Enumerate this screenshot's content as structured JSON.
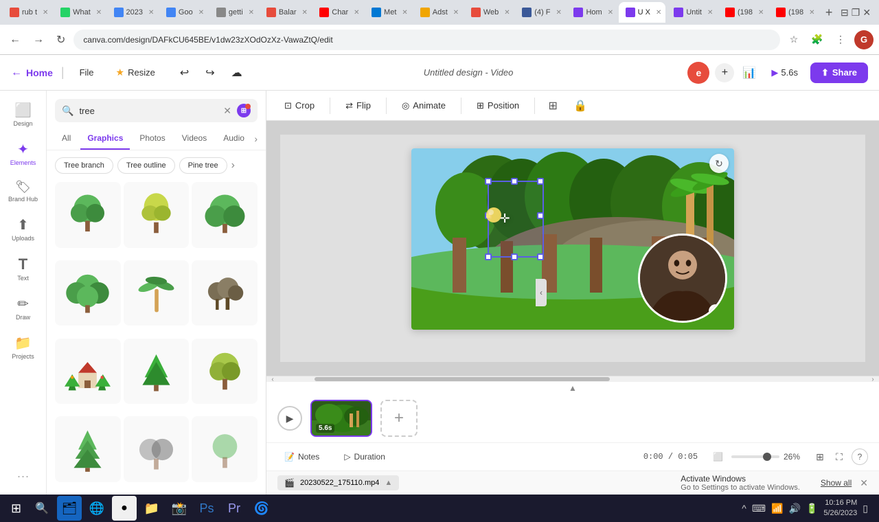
{
  "browser": {
    "url": "canva.com/design/DAFkCU645BE/v1dw23zXOdOzXz-VawaZtQ/edit",
    "tabs": [
      {
        "label": "rub t",
        "active": false,
        "favicon": "🔴"
      },
      {
        "label": "What",
        "active": false,
        "favicon": "💬"
      },
      {
        "label": "2023",
        "active": false,
        "favicon": "🌐"
      },
      {
        "label": "Goo",
        "active": false,
        "favicon": "🌐"
      },
      {
        "label": "getti",
        "active": false,
        "favicon": "🌐"
      },
      {
        "label": "Balar",
        "active": false,
        "favicon": "🌐"
      },
      {
        "label": "Char",
        "active": false,
        "favicon": "📺"
      },
      {
        "label": "Met",
        "active": false,
        "favicon": "🌐"
      },
      {
        "label": "Adst",
        "active": false,
        "favicon": "🌐"
      },
      {
        "label": "Web",
        "active": false,
        "favicon": "🌐"
      },
      {
        "label": "(4) F",
        "active": false,
        "favicon": "📘"
      },
      {
        "label": "Hom",
        "active": false,
        "favicon": "🌐"
      },
      {
        "label": "U X",
        "active": true,
        "favicon": "🌐"
      },
      {
        "label": "Untit",
        "active": false,
        "favicon": "🌐"
      },
      {
        "label": "(198",
        "active": false,
        "favicon": "📺"
      },
      {
        "label": "(198",
        "active": false,
        "favicon": "📺"
      }
    ]
  },
  "toolbar": {
    "home_label": "Home",
    "file_label": "File",
    "resize_label": "Resize",
    "title": "Untitled design - Video",
    "play_label": "5.6s",
    "share_label": "Share",
    "undo_symbol": "↩",
    "redo_symbol": "↪",
    "save_symbol": "☁"
  },
  "sidebar": {
    "items": [
      {
        "label": "Design",
        "symbol": "⬜"
      },
      {
        "label": "Elements",
        "symbol": "✦",
        "active": true
      },
      {
        "label": "Brand Hub",
        "symbol": "🏷"
      },
      {
        "label": "Uploads",
        "symbol": "⬆"
      },
      {
        "label": "Text",
        "symbol": "T"
      },
      {
        "label": "Draw",
        "symbol": "✏"
      },
      {
        "label": "Projects",
        "symbol": "📁"
      }
    ]
  },
  "search": {
    "query": "tree",
    "placeholder": "tree",
    "filter_count": "3",
    "tabs": [
      "All",
      "Graphics",
      "Photos",
      "Videos",
      "Audio"
    ],
    "active_tab": "Graphics",
    "tags": [
      "Tree branch",
      "Tree outline",
      "Pine tree"
    ],
    "tag_arrow": "›"
  },
  "canvas": {
    "tools": [
      "Crop",
      "Flip",
      "Animate",
      "Position"
    ],
    "animate_label": "Animate",
    "crop_label": "Crop",
    "flip_label": "Flip",
    "position_label": "Position"
  },
  "timeline": {
    "clip_duration": "5.6s",
    "time_current": "0:00",
    "time_total": "0:05",
    "zoom_percent": "26%",
    "notes_label": "Notes",
    "duration_label": "Duration"
  },
  "bottom": {
    "activate_title": "Activate Windows",
    "activate_sub": "Go to Settings to activate Windows.",
    "show_all_label": "Show all",
    "file_label": "20230522_175110.mp4"
  },
  "taskbar": {
    "time": "10:16 PM",
    "date": "5/26/2023"
  }
}
